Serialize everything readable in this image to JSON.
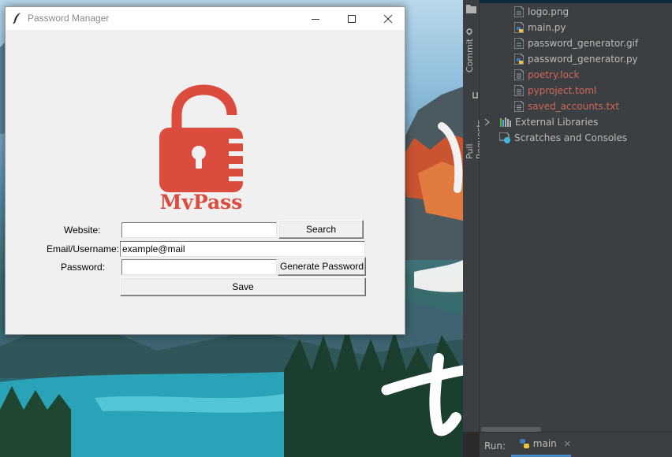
{
  "window": {
    "title": "Password Manager"
  },
  "logo": {
    "text": "MyPass",
    "color": "#db4b3e"
  },
  "form": {
    "website_label": "Website:",
    "website_value": "",
    "email_label": "Email/Username:",
    "email_value": "example@mail",
    "password_label": "Password:",
    "password_value": "",
    "search_button": "Search",
    "generate_button": "Generate Password",
    "save_button": "Save"
  },
  "ide": {
    "sidebar_tabs": [
      {
        "label": "Commit"
      },
      {
        "label": "Pull Requests"
      }
    ],
    "project_tree": [
      {
        "name": "logo.png",
        "icon": "image-file-icon",
        "untracked": false
      },
      {
        "name": "main.py",
        "icon": "python-file-icon",
        "untracked": false
      },
      {
        "name": "password_generator.gif",
        "icon": "image-file-icon",
        "untracked": false
      },
      {
        "name": "password_generator.py",
        "icon": "python-file-icon",
        "untracked": false
      },
      {
        "name": "poetry.lock",
        "icon": "text-file-icon",
        "untracked": true
      },
      {
        "name": "pyproject.toml",
        "icon": "text-file-icon",
        "untracked": true
      },
      {
        "name": "saved_accounts.txt",
        "icon": "text-file-icon",
        "untracked": true
      },
      {
        "name": "External Libraries",
        "icon": "library-icon",
        "untracked": false
      },
      {
        "name": "Scratches and Consoles",
        "icon": "scratches-icon",
        "untracked": false
      }
    ],
    "run_bar": {
      "label": "Run:",
      "tab": "main"
    },
    "colors": {
      "untracked": "#d1675a",
      "panel": "#3c3f41",
      "accent": "#4a88c7"
    }
  }
}
